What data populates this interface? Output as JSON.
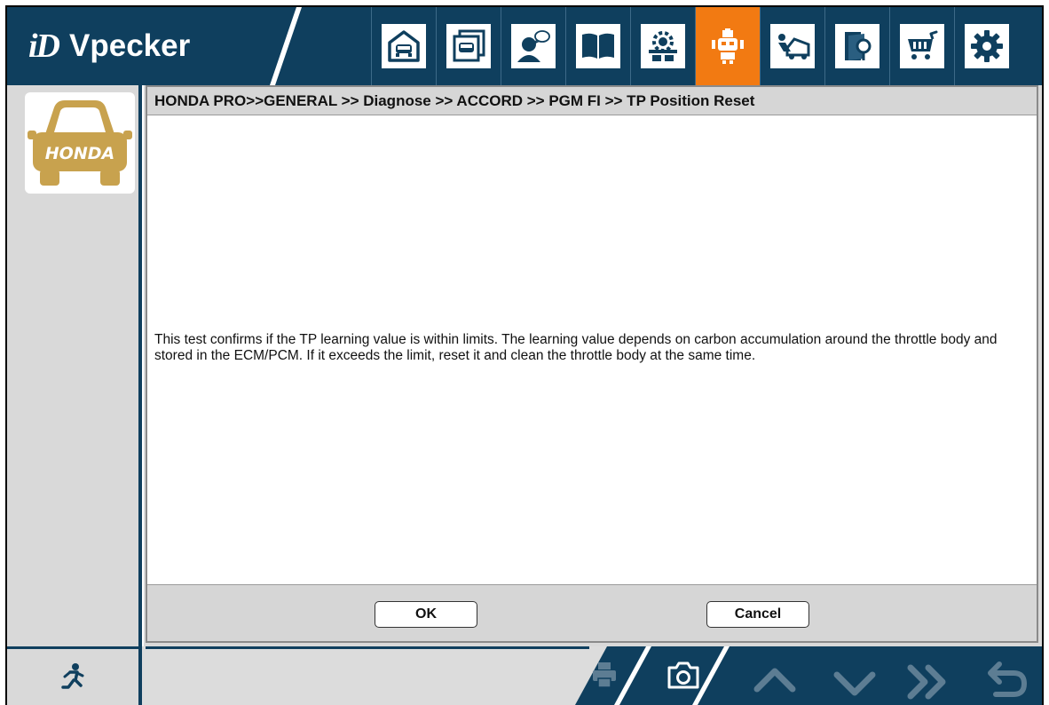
{
  "app": {
    "logo_mark": "iD",
    "logo_name": "Vpecker"
  },
  "toolbar": {
    "items": [
      {
        "icon": "garage-home-icon"
      },
      {
        "icon": "vehicle-list-icon"
      },
      {
        "icon": "support-chat-icon"
      },
      {
        "icon": "manual-book-icon"
      },
      {
        "icon": "settings-service-icon"
      },
      {
        "icon": "diagnosis-robot-icon",
        "active": true
      },
      {
        "icon": "car-repair-icon"
      },
      {
        "icon": "search-book-icon"
      },
      {
        "icon": "shopping-cart-icon"
      },
      {
        "icon": "gear-icon"
      }
    ]
  },
  "sidebar": {
    "brand_label": "HONDA"
  },
  "breadcrumb": "HONDA PRO>>GENERAL >> Diagnose >> ACCORD >> PGM FI >> TP Position Reset",
  "message": "This test confirms if the TP learning value is within limits. The learning value depends on carbon accumulation around the throttle body and stored in the ECM/PCM. If it exceeds the limit, reset it and clean the throttle body at the same time.",
  "buttons": {
    "ok": "OK",
    "cancel": "Cancel"
  },
  "footer": {
    "icons": [
      "exit-run-icon",
      "print-icon",
      "camera-icon",
      "chevron-up-icon",
      "chevron-down-icon",
      "double-chevron-right-icon",
      "back-arrow-icon"
    ]
  },
  "colors": {
    "header_bg": "#0f3f5e",
    "active_tab": "#f27a12",
    "honda_gold": "#c8a24e",
    "nav_disabled": "#5d7d93"
  }
}
